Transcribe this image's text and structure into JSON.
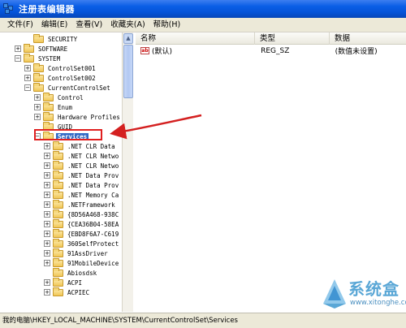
{
  "window": {
    "title": "注册表编辑器"
  },
  "menu": [
    "文件(F)",
    "编辑(E)",
    "查看(V)",
    "收藏夹(A)",
    "帮助(H)"
  ],
  "tree": [
    {
      "label": "SECURITY",
      "expander": ""
    },
    {
      "label": "SOFTWARE",
      "expander": "+"
    },
    {
      "label": "SYSTEM",
      "expander": "−"
    },
    {
      "label": "ControlSet001",
      "expander": "+"
    },
    {
      "label": "ControlSet002",
      "expander": "+"
    },
    {
      "label": "CurrentControlSet",
      "expander": "−"
    },
    {
      "label": "Control",
      "expander": "+"
    },
    {
      "label": "Enum",
      "expander": "+"
    },
    {
      "label": "Hardware Profiles",
      "expander": "+"
    },
    {
      "label": "GUID",
      "expander": ""
    },
    {
      "label": "Services",
      "expander": "−",
      "selected": true
    },
    {
      "label": ".NET CLR Data",
      "expander": "+"
    },
    {
      "label": ".NET CLR Netwo",
      "expander": "+"
    },
    {
      "label": ".NET CLR Netwo",
      "expander": "+"
    },
    {
      "label": ".NET Data Prov",
      "expander": "+"
    },
    {
      "label": ".NET Data Prov",
      "expander": "+"
    },
    {
      "label": ".NET Memory Ca",
      "expander": "+"
    },
    {
      "label": ".NETFramework",
      "expander": "+"
    },
    {
      "label": "{8D56A468-938C",
      "expander": "+"
    },
    {
      "label": "{CEA36B04-58EA",
      "expander": "+"
    },
    {
      "label": "{EBD8F6A7-C619",
      "expander": "+"
    },
    {
      "label": "360SelfProtect",
      "expander": "+"
    },
    {
      "label": "91AssDriver",
      "expander": "+"
    },
    {
      "label": "91MobileDevice",
      "expander": "+"
    },
    {
      "label": "Abiosdsk",
      "expander": ""
    },
    {
      "label": "ACPI",
      "expander": "+"
    },
    {
      "label": "ACPIEC",
      "expander": "+"
    }
  ],
  "list": {
    "columns": [
      "名称",
      "类型",
      "数据"
    ],
    "rows": [
      {
        "icon": "ab",
        "name": "(默认)",
        "type": "REG_SZ",
        "data": "(数值未设置)"
      }
    ]
  },
  "status": {
    "path": "我的电脑\\HKEY_LOCAL_MACHINE\\SYSTEM\\CurrentControlSet\\Services"
  },
  "watermark": {
    "brand": "系统盒",
    "url": "www.xitonghe.com"
  },
  "colors": {
    "arrow": "#d42020",
    "selection": "#316ac5",
    "titlebar": "#0a5ee6",
    "watermark": "#5aa7d6"
  }
}
